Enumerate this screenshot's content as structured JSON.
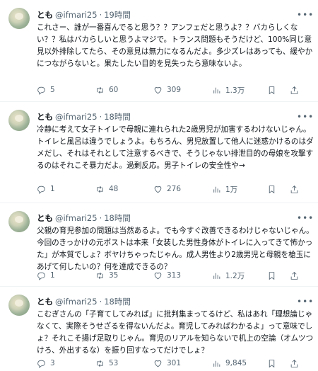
{
  "tweets": [
    {
      "name": "とも",
      "handle": "@ifmari25",
      "time": "19時間",
      "text": "これさー、誰が一番喜んでると思う？？アンフェだと思うよ？？バカらしくない？？私はバカらしいと思うよマジで。トランス問題もそうだけど、100%同じ意見以外排除してたら、その意見は無力になるんだよ。多少ズレはあっても、緩やかにつながらないと。果たしたい目的を見失ったら意味ないよ。",
      "replies": "5",
      "retweets": "60",
      "likes": "309",
      "views": "1.3万"
    },
    {
      "name": "とも",
      "handle": "@ifmari25",
      "time": "18時間",
      "text": "冷静に考えて女子トイレで母親に連れられた2歳男児が加害するわけないじゃん。トイレと風呂は違うでしょうよ。もちろん、男児放置して他人に迷惑かけるのはダメだし、それはそれとして注意するべきで、そうじゃない排泄目的の母娘を攻撃するのはそれこそ暴力だよ。過剰反応。男子トイレの安全性や→",
      "replies": "1",
      "retweets": "48",
      "likes": "276",
      "views": "1万"
    },
    {
      "name": "とも",
      "handle": "@ifmari25",
      "time": "18時間",
      "text": "父親の育児参加の問題は当然あるよ。でも今すぐ改善できるわけじゃないじゃん。今回のきっかけの元ポストは本来「女装した男性身体がトイレに入ってきて怖かった」が本質でしょ？ボヤけちゃったじゃん。成人男性より2歳男児と母親を槍玉にあげて何したいの？何を達成できるの？",
      "replies": "1",
      "retweets": "35",
      "likes": "313",
      "views": "1.2万"
    },
    {
      "name": "とも",
      "handle": "@ifmari25",
      "time": "18時間",
      "text": "こむぎさんの「子育てしてみれば」に批判集まってるけど、私はあれ「理想論じゃなくて、実際そうせざるを得ないんだよ。育児してみればわかるよ」って意味でしょ？それこそ揚げ足取りじゃん。育児のリアルを知らないで机上の空論（オムツつけろ、外出するな）を振り回すなってだけでしょ？",
      "replies": "3",
      "retweets": "53",
      "likes": "301",
      "views": "9,845"
    }
  ],
  "icons": {
    "reply": "reply-icon",
    "retweet": "retweet-icon",
    "like": "heart-icon",
    "views": "views-icon",
    "bookmark": "bookmark-icon",
    "share": "share-icon",
    "more": "more-icon"
  }
}
